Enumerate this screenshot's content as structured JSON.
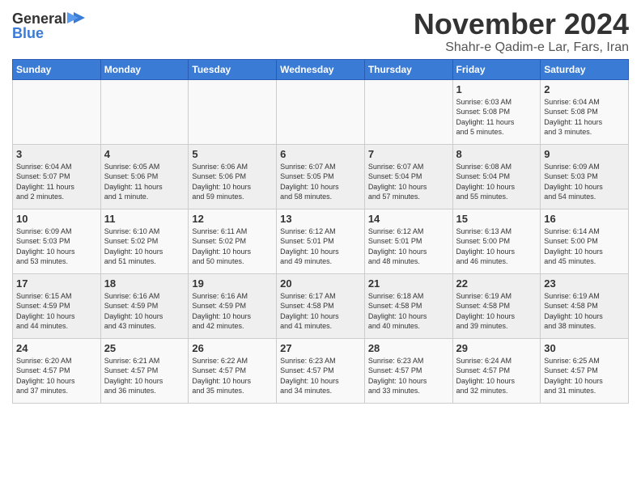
{
  "logo": {
    "general": "General",
    "blue": "Blue"
  },
  "title": "November 2024",
  "location": "Shahr-e Qadim-e Lar, Fars, Iran",
  "headers": [
    "Sunday",
    "Monday",
    "Tuesday",
    "Wednesday",
    "Thursday",
    "Friday",
    "Saturday"
  ],
  "weeks": [
    [
      {
        "day": "",
        "info": ""
      },
      {
        "day": "",
        "info": ""
      },
      {
        "day": "",
        "info": ""
      },
      {
        "day": "",
        "info": ""
      },
      {
        "day": "",
        "info": ""
      },
      {
        "day": "1",
        "info": "Sunrise: 6:03 AM\nSunset: 5:08 PM\nDaylight: 11 hours\nand 5 minutes."
      },
      {
        "day": "2",
        "info": "Sunrise: 6:04 AM\nSunset: 5:08 PM\nDaylight: 11 hours\nand 3 minutes."
      }
    ],
    [
      {
        "day": "3",
        "info": "Sunrise: 6:04 AM\nSunset: 5:07 PM\nDaylight: 11 hours\nand 2 minutes."
      },
      {
        "day": "4",
        "info": "Sunrise: 6:05 AM\nSunset: 5:06 PM\nDaylight: 11 hours\nand 1 minute."
      },
      {
        "day": "5",
        "info": "Sunrise: 6:06 AM\nSunset: 5:06 PM\nDaylight: 10 hours\nand 59 minutes."
      },
      {
        "day": "6",
        "info": "Sunrise: 6:07 AM\nSunset: 5:05 PM\nDaylight: 10 hours\nand 58 minutes."
      },
      {
        "day": "7",
        "info": "Sunrise: 6:07 AM\nSunset: 5:04 PM\nDaylight: 10 hours\nand 57 minutes."
      },
      {
        "day": "8",
        "info": "Sunrise: 6:08 AM\nSunset: 5:04 PM\nDaylight: 10 hours\nand 55 minutes."
      },
      {
        "day": "9",
        "info": "Sunrise: 6:09 AM\nSunset: 5:03 PM\nDaylight: 10 hours\nand 54 minutes."
      }
    ],
    [
      {
        "day": "10",
        "info": "Sunrise: 6:09 AM\nSunset: 5:03 PM\nDaylight: 10 hours\nand 53 minutes."
      },
      {
        "day": "11",
        "info": "Sunrise: 6:10 AM\nSunset: 5:02 PM\nDaylight: 10 hours\nand 51 minutes."
      },
      {
        "day": "12",
        "info": "Sunrise: 6:11 AM\nSunset: 5:02 PM\nDaylight: 10 hours\nand 50 minutes."
      },
      {
        "day": "13",
        "info": "Sunrise: 6:12 AM\nSunset: 5:01 PM\nDaylight: 10 hours\nand 49 minutes."
      },
      {
        "day": "14",
        "info": "Sunrise: 6:12 AM\nSunset: 5:01 PM\nDaylight: 10 hours\nand 48 minutes."
      },
      {
        "day": "15",
        "info": "Sunrise: 6:13 AM\nSunset: 5:00 PM\nDaylight: 10 hours\nand 46 minutes."
      },
      {
        "day": "16",
        "info": "Sunrise: 6:14 AM\nSunset: 5:00 PM\nDaylight: 10 hours\nand 45 minutes."
      }
    ],
    [
      {
        "day": "17",
        "info": "Sunrise: 6:15 AM\nSunset: 4:59 PM\nDaylight: 10 hours\nand 44 minutes."
      },
      {
        "day": "18",
        "info": "Sunrise: 6:16 AM\nSunset: 4:59 PM\nDaylight: 10 hours\nand 43 minutes."
      },
      {
        "day": "19",
        "info": "Sunrise: 6:16 AM\nSunset: 4:59 PM\nDaylight: 10 hours\nand 42 minutes."
      },
      {
        "day": "20",
        "info": "Sunrise: 6:17 AM\nSunset: 4:58 PM\nDaylight: 10 hours\nand 41 minutes."
      },
      {
        "day": "21",
        "info": "Sunrise: 6:18 AM\nSunset: 4:58 PM\nDaylight: 10 hours\nand 40 minutes."
      },
      {
        "day": "22",
        "info": "Sunrise: 6:19 AM\nSunset: 4:58 PM\nDaylight: 10 hours\nand 39 minutes."
      },
      {
        "day": "23",
        "info": "Sunrise: 6:19 AM\nSunset: 4:58 PM\nDaylight: 10 hours\nand 38 minutes."
      }
    ],
    [
      {
        "day": "24",
        "info": "Sunrise: 6:20 AM\nSunset: 4:57 PM\nDaylight: 10 hours\nand 37 minutes."
      },
      {
        "day": "25",
        "info": "Sunrise: 6:21 AM\nSunset: 4:57 PM\nDaylight: 10 hours\nand 36 minutes."
      },
      {
        "day": "26",
        "info": "Sunrise: 6:22 AM\nSunset: 4:57 PM\nDaylight: 10 hours\nand 35 minutes."
      },
      {
        "day": "27",
        "info": "Sunrise: 6:23 AM\nSunset: 4:57 PM\nDaylight: 10 hours\nand 34 minutes."
      },
      {
        "day": "28",
        "info": "Sunrise: 6:23 AM\nSunset: 4:57 PM\nDaylight: 10 hours\nand 33 minutes."
      },
      {
        "day": "29",
        "info": "Sunrise: 6:24 AM\nSunset: 4:57 PM\nDaylight: 10 hours\nand 32 minutes."
      },
      {
        "day": "30",
        "info": "Sunrise: 6:25 AM\nSunset: 4:57 PM\nDaylight: 10 hours\nand 31 minutes."
      }
    ]
  ]
}
